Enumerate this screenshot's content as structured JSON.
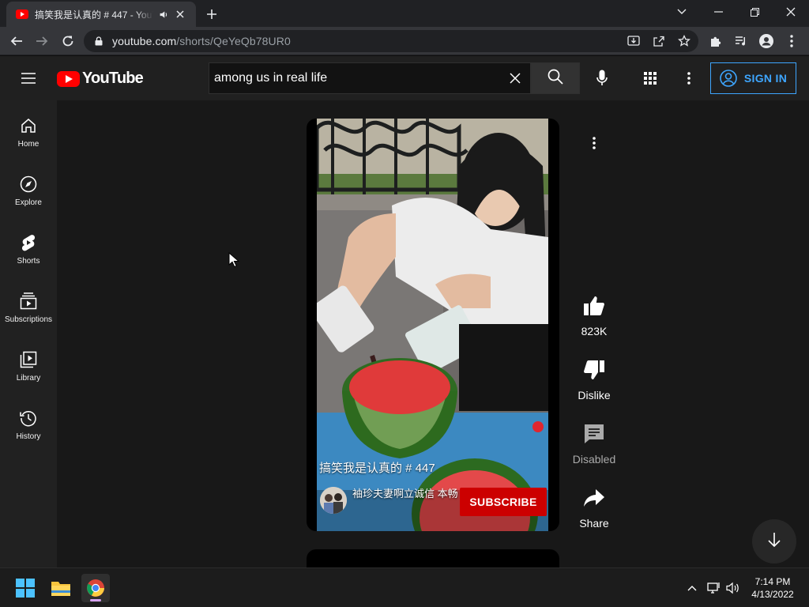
{
  "browser": {
    "tab_title": "搞笑我是认真的 # 447 - YouTube",
    "url_domain": "youtube.com",
    "url_path": "/shorts/QeYeQb78UR0"
  },
  "masthead": {
    "logo_text": "YouTube",
    "search_value": "among us in real life",
    "sign_in_label": "SIGN IN"
  },
  "sidebar": {
    "items": [
      {
        "label": "Home",
        "icon": "home-icon"
      },
      {
        "label": "Explore",
        "icon": "compass-icon"
      },
      {
        "label": "Shorts",
        "icon": "shorts-icon"
      },
      {
        "label": "Subscriptions",
        "icon": "subscriptions-icon"
      },
      {
        "label": "Library",
        "icon": "library-icon"
      },
      {
        "label": "History",
        "icon": "history-icon"
      }
    ]
  },
  "short": {
    "title": "搞笑我是认真的 # 447",
    "channel_name": "袖珍夫妻啊立诚信 本畅",
    "subscribe_label": "SUBSCRIBE"
  },
  "actions": {
    "like_count": "823K",
    "dislike_label": "Dislike",
    "comments_label": "Disabled",
    "share_label": "Share"
  },
  "taskbar": {
    "time": "7:14 PM",
    "date": "4/13/2022"
  },
  "colors": {
    "brand_red": "#ff0000",
    "link_blue": "#3ea6ff",
    "subscribe_red": "#cc0000"
  }
}
